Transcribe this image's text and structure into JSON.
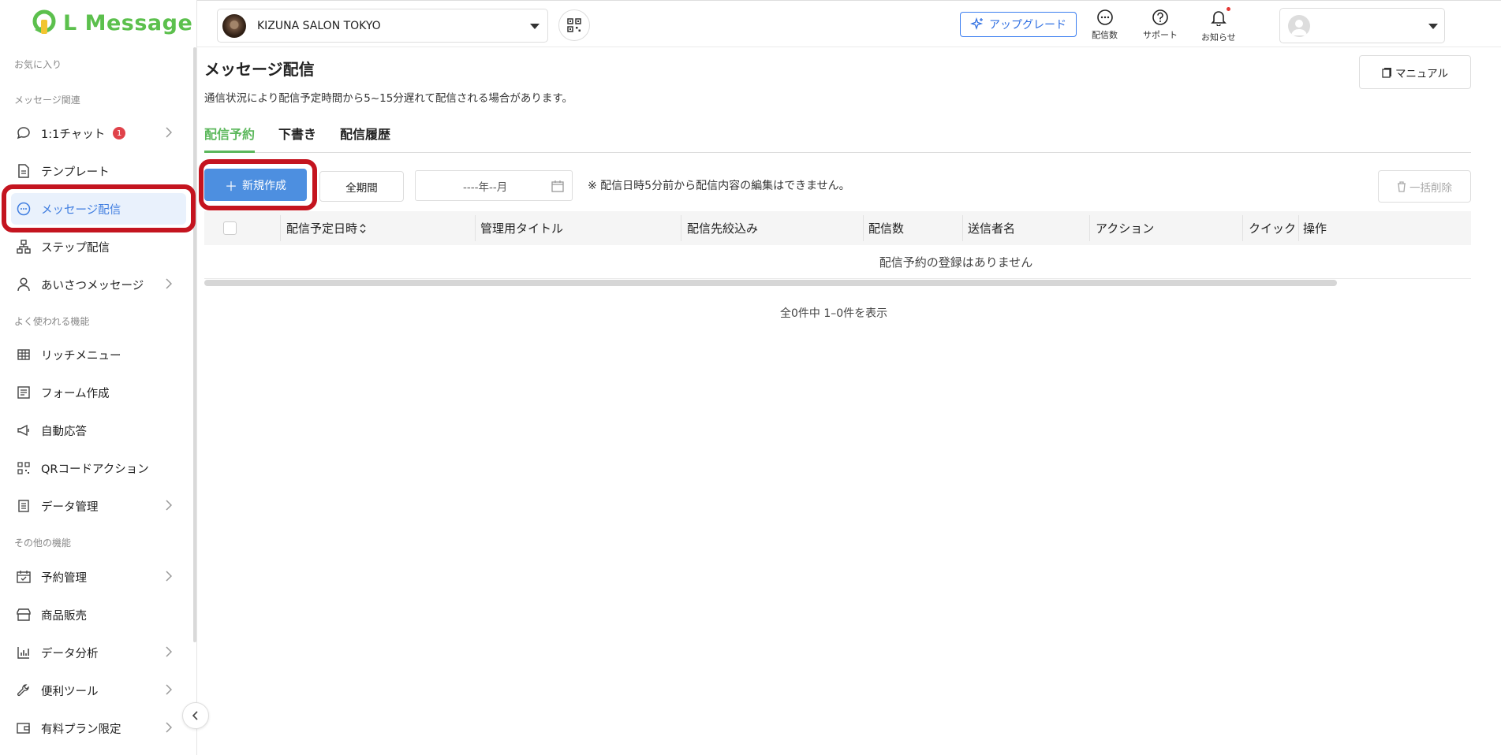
{
  "app": {
    "logo_text": "L Message"
  },
  "sidebar": {
    "sections": {
      "favorites": "お気に入り",
      "message_related": "メッセージ関連",
      "frequently_used": "よく使われる機能",
      "other": "その他の機能"
    },
    "items": [
      {
        "label": "1:1チャット",
        "badge": "1"
      },
      {
        "label": "テンプレート"
      },
      {
        "label": "メッセージ配信"
      },
      {
        "label": "ステップ配信"
      },
      {
        "label": "あいさつメッセージ"
      },
      {
        "label": "リッチメニュー"
      },
      {
        "label": "フォーム作成"
      },
      {
        "label": "自動応答"
      },
      {
        "label": "QRコードアクション"
      },
      {
        "label": "データ管理"
      },
      {
        "label": "予約管理"
      },
      {
        "label": "商品販売"
      },
      {
        "label": "データ分析"
      },
      {
        "label": "便利ツール"
      },
      {
        "label": "有料プラン限定"
      }
    ]
  },
  "header": {
    "account_name": "KIZUNA SALON TOKYO",
    "upgrade_label": "アップグレード",
    "icons": [
      {
        "label": "配信数"
      },
      {
        "label": "サポート"
      },
      {
        "label": "お知らせ"
      }
    ]
  },
  "main": {
    "title": "メッセージ配信",
    "subtitle": "通信状況により配信予定時間から5~15分遅れて配信される場合があります。",
    "manual_label": "マニュアル",
    "tabs": [
      {
        "label": "配信予約"
      },
      {
        "label": "下書き"
      },
      {
        "label": "配信履歴"
      }
    ],
    "new_button": "新規作成",
    "period_button": "全期間",
    "month_placeholder": "----年--月",
    "edit_note": "※ 配信日時5分前から配信内容の編集はできません。",
    "bulk_delete": "一括削除",
    "table": {
      "columns": [
        "配信予定日時",
        "管理用タイトル",
        "配信先絞込み",
        "配信数",
        "送信者名",
        "アクション",
        "クイック",
        "操作"
      ],
      "empty_text": "配信予約の登録はありません"
    },
    "pager_text": "全0件中 1–0件を表示"
  },
  "colors": {
    "accent_green": "#5cb85c",
    "primary_blue": "#4d8fe0",
    "highlight_red": "#c4141f"
  }
}
